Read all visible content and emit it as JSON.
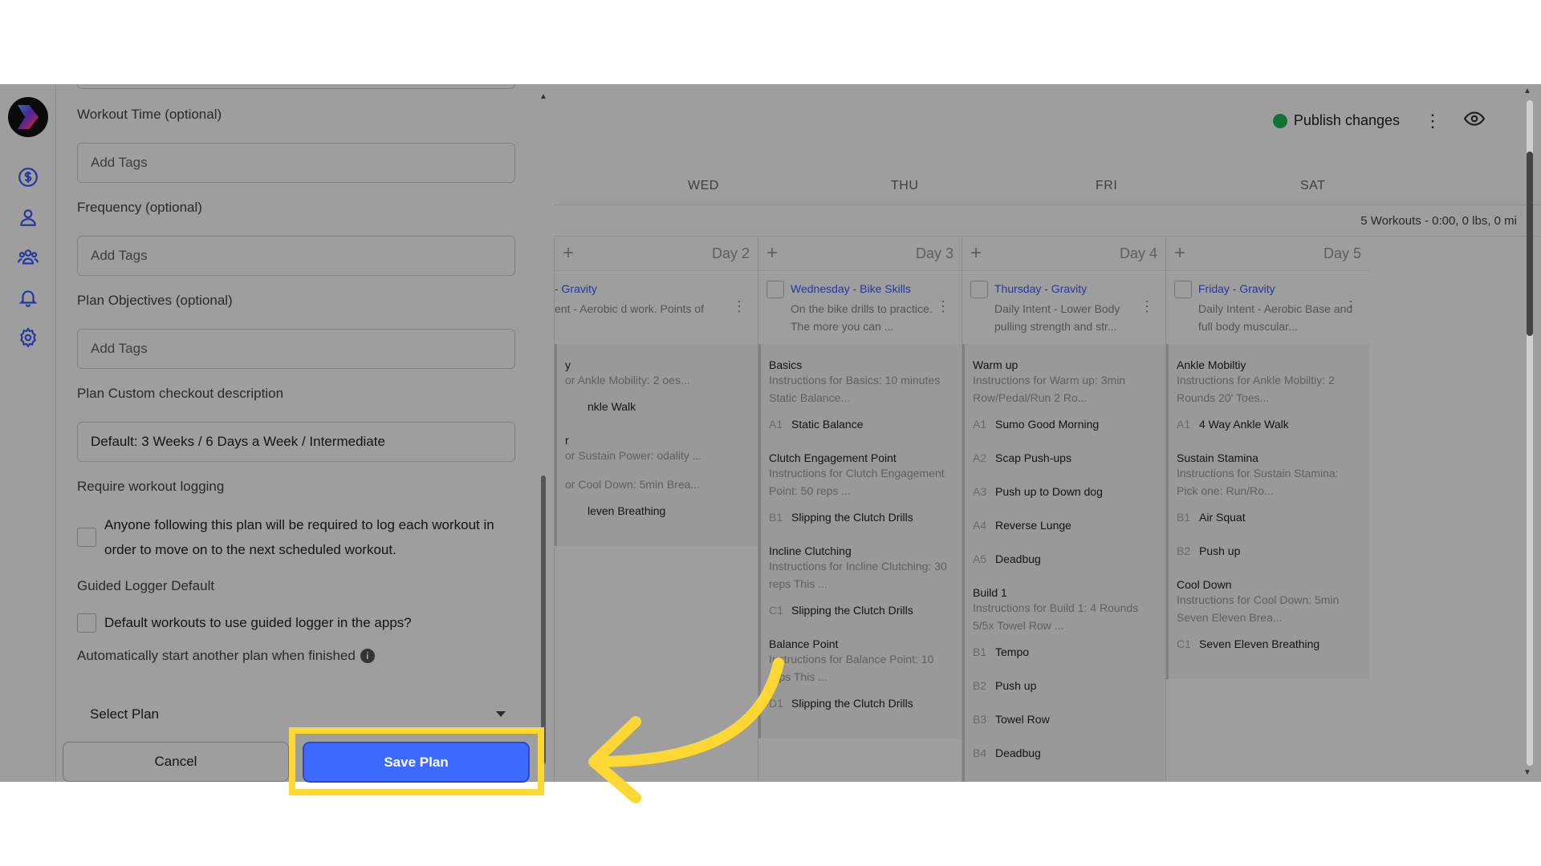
{
  "topbar": {
    "publish_label": "Publish changes"
  },
  "days": [
    "WED",
    "THU",
    "FRI",
    "SAT"
  ],
  "summary": "5 Workouts - 0:00, 0 lbs, 0 mi",
  "columns": [
    {
      "day_label": "Day 2",
      "title": "- Gravity",
      "desc": "ent - Aerobic d work. Points of",
      "sections": [
        {
          "name": "y",
          "desc": "or Ankle Mobility: 2 oes...",
          "exercises": [
            {
              "code": "",
              "name": "nkle Walk"
            }
          ]
        },
        {
          "name": "r",
          "desc": "or Sustain Power: odality ...",
          "exercises": []
        },
        {
          "name": "",
          "desc": "or Cool Down: 5min Brea...",
          "exercises": [
            {
              "code": "",
              "name": "leven Breathing"
            }
          ]
        }
      ]
    },
    {
      "day_label": "Day 3",
      "title": "Wednesday - Bike Skills",
      "desc": "On the bike drills to practice. The more you can ...",
      "sections": [
        {
          "name": "Basics",
          "desc": "Instructions for Basics: 10 minutes Static Balance...",
          "exercises": [
            {
              "code": "A1",
              "name": "Static Balance"
            }
          ]
        },
        {
          "name": "Clutch Engagement Point",
          "desc": "Instructions for Clutch Engagement Point: 50 reps ...",
          "exercises": [
            {
              "code": "B1",
              "name": "Slipping the Clutch Drills"
            }
          ]
        },
        {
          "name": "Incline Clutching",
          "desc": "Instructions for Incline Clutching: 30 reps This ...",
          "exercises": [
            {
              "code": "C1",
              "name": "Slipping the Clutch Drills"
            }
          ]
        },
        {
          "name": "Balance Point",
          "desc": "Instructions for Balance Point: 10 reps This ...",
          "exercises": [
            {
              "code": "D1",
              "name": "Slipping the Clutch Drills"
            }
          ]
        }
      ]
    },
    {
      "day_label": "Day 4",
      "title": "Thursday - Gravity",
      "desc": "Daily Intent - Lower Body pulling strength and str...",
      "sections": [
        {
          "name": "Warm up",
          "desc": "Instructions for Warm up: 3min Row/Pedal/Run 2 Ro...",
          "exercises": [
            {
              "code": "A1",
              "name": "Sumo Good Morning"
            },
            {
              "code": "A2",
              "name": "Scap Push-ups"
            },
            {
              "code": "A3",
              "name": "Push up to Down dog"
            },
            {
              "code": "A4",
              "name": "Reverse Lunge"
            },
            {
              "code": "A5",
              "name": "Deadbug"
            }
          ]
        },
        {
          "name": "Build 1",
          "desc": "Instructions for Build 1: 4 Rounds 5/5x Towel Row ...",
          "exercises": [
            {
              "code": "B1",
              "name": "Tempo"
            },
            {
              "code": "B2",
              "name": "Push up"
            },
            {
              "code": "B3",
              "name": "Towel Row"
            },
            {
              "code": "B4",
              "name": "Deadbug"
            }
          ]
        }
      ]
    },
    {
      "day_label": "Day 5",
      "title": "Friday - Gravity",
      "desc": "Daily Intent - Aerobic Base and full body muscular...",
      "sections": [
        {
          "name": "Ankle Mobiltiy",
          "desc": "Instructions for Ankle Mobiltiy: 2 Rounds 20' Toes...",
          "exercises": [
            {
              "code": "A1",
              "name": "4 Way Ankle Walk"
            }
          ]
        },
        {
          "name": "Sustain Stamina",
          "desc": "Instructions for Sustain Stamina: Pick one: Run/Ro...",
          "exercises": [
            {
              "code": "B1",
              "name": "Air Squat"
            },
            {
              "code": "B2",
              "name": "Push up"
            }
          ]
        },
        {
          "name": "Cool Down",
          "desc": "Instructions for Cool Down: 5min Seven Eleven Brea...",
          "exercises": [
            {
              "code": "C1",
              "name": "Seven Eleven Breathing"
            }
          ]
        }
      ]
    }
  ],
  "form": {
    "workout_time_label": "Workout Time (optional)",
    "workout_time_placeholder": "Add Tags",
    "frequency_label": "Frequency (optional)",
    "frequency_placeholder": "Add Tags",
    "objectives_label": "Plan Objectives (optional)",
    "objectives_placeholder": "Add Tags",
    "checkout_label": "Plan Custom checkout description",
    "checkout_value": "Default: 3 Weeks / 6 Days a Week / Intermediate",
    "logging_label": "Require workout logging",
    "logging_text": "Anyone following this plan will be required to log each workout in order to move on to the next scheduled workout.",
    "guided_label": "Guided Logger Default",
    "guided_text": "Default workouts to use guided logger in the apps?",
    "autostart_label": "Automatically start another plan when finished",
    "info_glyph": "i",
    "select_plan": "Select Plan",
    "cancel": "Cancel",
    "save": "Save Plan"
  },
  "colors": {
    "accent": "#3d6bff",
    "highlight": "#fdd835",
    "publish_dot": "#1db954"
  }
}
